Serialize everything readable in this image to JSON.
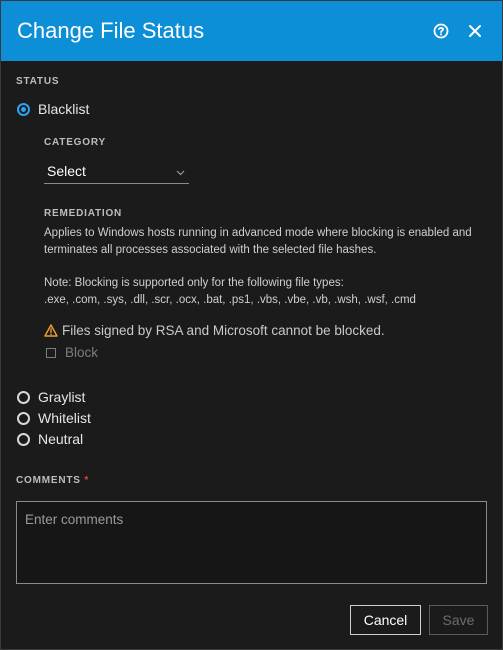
{
  "dialog": {
    "title": "Change File Status",
    "help_icon": "help-circle-icon",
    "close_icon": "close-icon"
  },
  "status": {
    "label": "STATUS",
    "options": [
      {
        "label": "Blacklist",
        "checked": true
      },
      {
        "label": "Graylist",
        "checked": false
      },
      {
        "label": "Whitelist",
        "checked": false
      },
      {
        "label": "Neutral",
        "checked": false
      }
    ]
  },
  "category": {
    "label": "CATEGORY",
    "selected": "Select"
  },
  "remediation": {
    "label": "REMEDIATION",
    "description": "Applies to Windows hosts running in advanced mode where blocking is enabled and terminates all processes associated with the selected file hashes.",
    "note_line1": "Note: Blocking is supported only for the following file types:",
    "note_line2": ".exe, .com, .sys, .dll, .scr, .ocx, .bat, .ps1, .vbs, .vbe, .vb, .wsh, .wsf, .cmd",
    "warning": "Files signed by RSA and Microsoft cannot be blocked.",
    "block_label": "Block"
  },
  "comments": {
    "label": "COMMENTS",
    "required_mark": "*",
    "placeholder": "Enter comments"
  },
  "buttons": {
    "cancel": "Cancel",
    "save": "Save"
  },
  "colors": {
    "header": "#0d8fd8",
    "accent": "#2ba3f0",
    "warning": "#f0a030",
    "required": "#e0463d"
  }
}
